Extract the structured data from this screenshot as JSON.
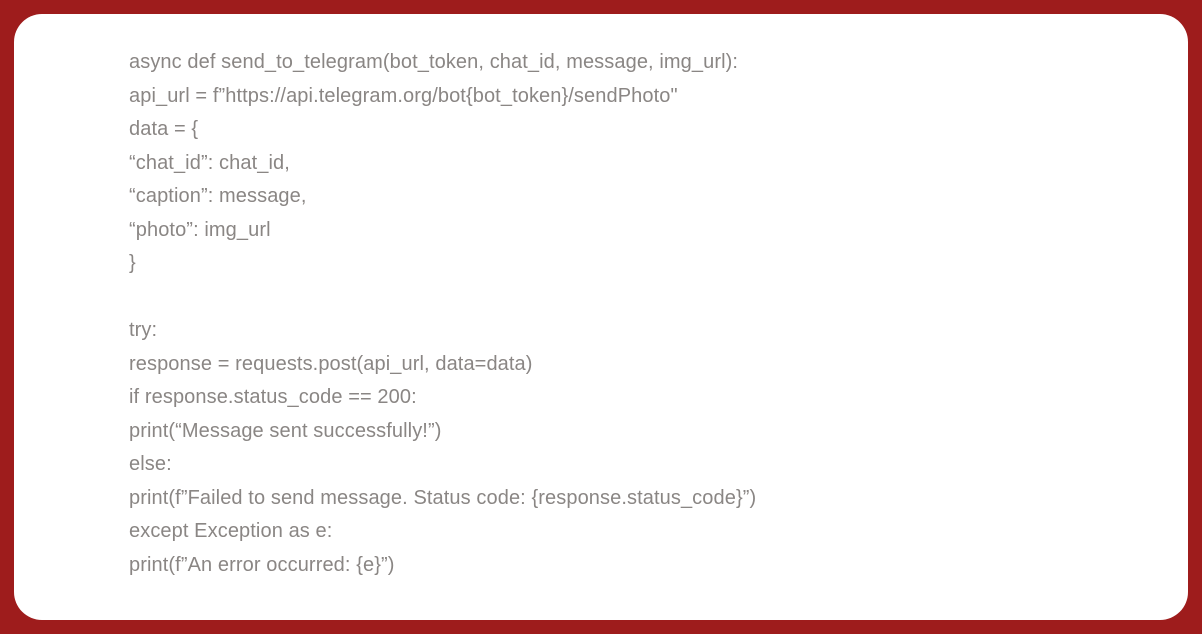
{
  "code": {
    "lines": [
      "async def send_to_telegram(bot_token, chat_id, message, img_url):",
      "api_url = f”https://api.telegram.org/bot{bot_token}/sendPhoto\"",
      "data = {",
      "“chat_id”: chat_id,",
      "“caption”: message,",
      "“photo”: img_url",
      "}",
      "",
      "try:",
      "response = requests.post(api_url, data=data)",
      "if response.status_code == 200:",
      "print(“Message sent successfully!”)",
      "else:",
      "print(f”Failed to send message. Status code: {response.status_code}”)",
      "except Exception as e:",
      "print(f”An error occurred: {e}”)"
    ]
  },
  "colors": {
    "background": "#9e1c1c",
    "container_bg": "#ffffff",
    "text": "#8a8684"
  }
}
